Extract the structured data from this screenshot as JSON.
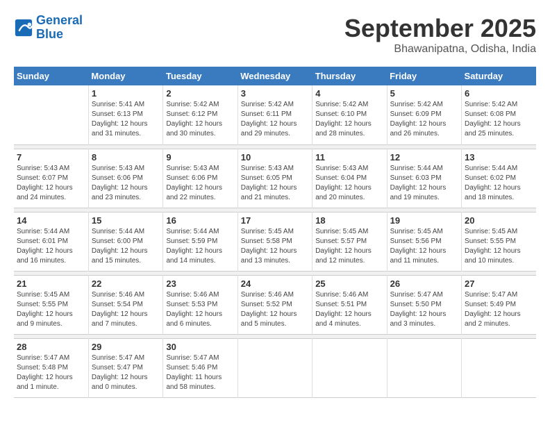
{
  "header": {
    "logo_line1": "General",
    "logo_line2": "Blue",
    "month_title": "September 2025",
    "location": "Bhawanipatna, Odisha, India"
  },
  "weekdays": [
    "Sunday",
    "Monday",
    "Tuesday",
    "Wednesday",
    "Thursday",
    "Friday",
    "Saturday"
  ],
  "weeks": [
    [
      {
        "day": "",
        "info": ""
      },
      {
        "day": "1",
        "info": "Sunrise: 5:41 AM\nSunset: 6:13 PM\nDaylight: 12 hours\nand 31 minutes."
      },
      {
        "day": "2",
        "info": "Sunrise: 5:42 AM\nSunset: 6:12 PM\nDaylight: 12 hours\nand 30 minutes."
      },
      {
        "day": "3",
        "info": "Sunrise: 5:42 AM\nSunset: 6:11 PM\nDaylight: 12 hours\nand 29 minutes."
      },
      {
        "day": "4",
        "info": "Sunrise: 5:42 AM\nSunset: 6:10 PM\nDaylight: 12 hours\nand 28 minutes."
      },
      {
        "day": "5",
        "info": "Sunrise: 5:42 AM\nSunset: 6:09 PM\nDaylight: 12 hours\nand 26 minutes."
      },
      {
        "day": "6",
        "info": "Sunrise: 5:42 AM\nSunset: 6:08 PM\nDaylight: 12 hours\nand 25 minutes."
      }
    ],
    [
      {
        "day": "7",
        "info": "Sunrise: 5:43 AM\nSunset: 6:07 PM\nDaylight: 12 hours\nand 24 minutes."
      },
      {
        "day": "8",
        "info": "Sunrise: 5:43 AM\nSunset: 6:06 PM\nDaylight: 12 hours\nand 23 minutes."
      },
      {
        "day": "9",
        "info": "Sunrise: 5:43 AM\nSunset: 6:06 PM\nDaylight: 12 hours\nand 22 minutes."
      },
      {
        "day": "10",
        "info": "Sunrise: 5:43 AM\nSunset: 6:05 PM\nDaylight: 12 hours\nand 21 minutes."
      },
      {
        "day": "11",
        "info": "Sunrise: 5:43 AM\nSunset: 6:04 PM\nDaylight: 12 hours\nand 20 minutes."
      },
      {
        "day": "12",
        "info": "Sunrise: 5:44 AM\nSunset: 6:03 PM\nDaylight: 12 hours\nand 19 minutes."
      },
      {
        "day": "13",
        "info": "Sunrise: 5:44 AM\nSunset: 6:02 PM\nDaylight: 12 hours\nand 18 minutes."
      }
    ],
    [
      {
        "day": "14",
        "info": "Sunrise: 5:44 AM\nSunset: 6:01 PM\nDaylight: 12 hours\nand 16 minutes."
      },
      {
        "day": "15",
        "info": "Sunrise: 5:44 AM\nSunset: 6:00 PM\nDaylight: 12 hours\nand 15 minutes."
      },
      {
        "day": "16",
        "info": "Sunrise: 5:44 AM\nSunset: 5:59 PM\nDaylight: 12 hours\nand 14 minutes."
      },
      {
        "day": "17",
        "info": "Sunrise: 5:45 AM\nSunset: 5:58 PM\nDaylight: 12 hours\nand 13 minutes."
      },
      {
        "day": "18",
        "info": "Sunrise: 5:45 AM\nSunset: 5:57 PM\nDaylight: 12 hours\nand 12 minutes."
      },
      {
        "day": "19",
        "info": "Sunrise: 5:45 AM\nSunset: 5:56 PM\nDaylight: 12 hours\nand 11 minutes."
      },
      {
        "day": "20",
        "info": "Sunrise: 5:45 AM\nSunset: 5:55 PM\nDaylight: 12 hours\nand 10 minutes."
      }
    ],
    [
      {
        "day": "21",
        "info": "Sunrise: 5:45 AM\nSunset: 5:55 PM\nDaylight: 12 hours\nand 9 minutes."
      },
      {
        "day": "22",
        "info": "Sunrise: 5:46 AM\nSunset: 5:54 PM\nDaylight: 12 hours\nand 7 minutes."
      },
      {
        "day": "23",
        "info": "Sunrise: 5:46 AM\nSunset: 5:53 PM\nDaylight: 12 hours\nand 6 minutes."
      },
      {
        "day": "24",
        "info": "Sunrise: 5:46 AM\nSunset: 5:52 PM\nDaylight: 12 hours\nand 5 minutes."
      },
      {
        "day": "25",
        "info": "Sunrise: 5:46 AM\nSunset: 5:51 PM\nDaylight: 12 hours\nand 4 minutes."
      },
      {
        "day": "26",
        "info": "Sunrise: 5:47 AM\nSunset: 5:50 PM\nDaylight: 12 hours\nand 3 minutes."
      },
      {
        "day": "27",
        "info": "Sunrise: 5:47 AM\nSunset: 5:49 PM\nDaylight: 12 hours\nand 2 minutes."
      }
    ],
    [
      {
        "day": "28",
        "info": "Sunrise: 5:47 AM\nSunset: 5:48 PM\nDaylight: 12 hours\nand 1 minute."
      },
      {
        "day": "29",
        "info": "Sunrise: 5:47 AM\nSunset: 5:47 PM\nDaylight: 12 hours\nand 0 minutes."
      },
      {
        "day": "30",
        "info": "Sunrise: 5:47 AM\nSunset: 5:46 PM\nDaylight: 11 hours\nand 58 minutes."
      },
      {
        "day": "",
        "info": ""
      },
      {
        "day": "",
        "info": ""
      },
      {
        "day": "",
        "info": ""
      },
      {
        "day": "",
        "info": ""
      }
    ]
  ]
}
